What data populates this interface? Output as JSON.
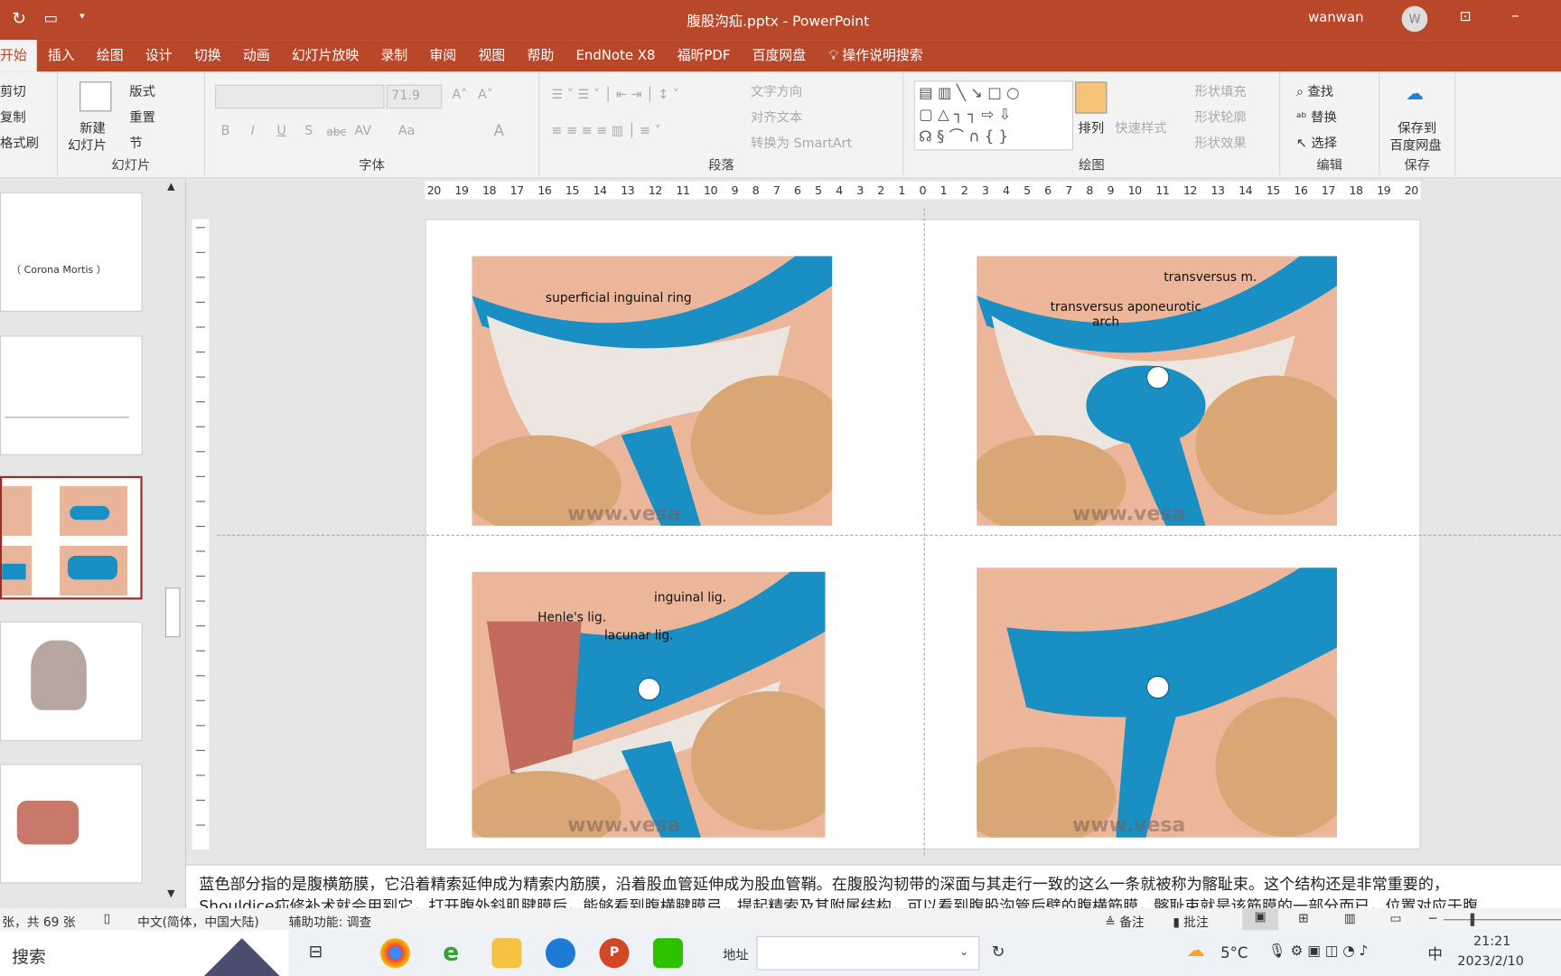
{
  "window": {
    "title": "腹股沟疝.pptx - PowerPoint",
    "user": "wanwan",
    "avatar": "W"
  },
  "tabs": [
    "开始",
    "插入",
    "绘图",
    "设计",
    "切换",
    "动画",
    "幻灯片放映",
    "录制",
    "审阅",
    "视图",
    "帮助",
    "EndNote X8",
    "福昕PDF",
    "百度网盘"
  ],
  "tell_me": "操作说明搜索",
  "ribbon": {
    "clipboard": {
      "cut": "剪切",
      "copy": "复制",
      "format_painter": "格式刷"
    },
    "slides": {
      "new_slide_1": "新建",
      "new_slide_2": "幻灯片",
      "layout": "版式",
      "reset": "重置",
      "section": "节",
      "label": "幻灯片"
    },
    "font": {
      "size": "71.9",
      "bold": "B",
      "italic": "I",
      "underline": "U",
      "shadow": "S",
      "strike": "abc",
      "spacing": "AV",
      "case": "Aa",
      "color": "A",
      "label": "字体"
    },
    "paragraph": {
      "text_direction": "文字方向",
      "align_text": "对齐文本",
      "smartart": "转换为 SmartArt",
      "label": "段落"
    },
    "drawing": {
      "arrange": "排列",
      "quick_styles": "快速样式",
      "fill": "形状填充",
      "outline": "形状轮廓",
      "effects": "形状效果",
      "label": "绘图"
    },
    "editing": {
      "find": "查找",
      "replace": "替换",
      "select": "选择",
      "label": "编辑"
    },
    "save": {
      "line1": "保存到",
      "line2": "百度网盘",
      "label": "保存"
    }
  },
  "ruler": [
    "20",
    "19",
    "18",
    "17",
    "16",
    "15",
    "14",
    "13",
    "12",
    "11",
    "10",
    "9",
    "8",
    "7",
    "6",
    "5",
    "4",
    "3",
    "2",
    "1",
    "0",
    "1",
    "2",
    "3",
    "4",
    "5",
    "6",
    "7",
    "8",
    "9",
    "10",
    "11",
    "12",
    "13",
    "14",
    "15",
    "16",
    "17",
    "18",
    "19",
    "20"
  ],
  "thumbnails": {
    "slide1_text": "（ Corona Mortis ）"
  },
  "slide": {
    "tl": {
      "label1": "superficial inguinal ring"
    },
    "tr": {
      "label1": "transversus m.",
      "label2": "transversus aponeurotic",
      "label3": "arch"
    },
    "bl": {
      "label1": "inguinal lig.",
      "label2": "Henle's lig.",
      "label3": "lacunar lig."
    },
    "watermark": "www.vesa"
  },
  "notes": {
    "line1": "蓝色部分指的是腹横筋膜，它沿着精索延伸成为精索内筋膜，沿着股血管延伸成为股血管鞘。在腹股沟韧带的深面与其走行一致的这么一条就被称为髂耻束。这个结构还是非常重要的，",
    "line2": "Shouldice疝修补术就会用到它，打开腹外斜肌腱膜后，能够看到腹横腱膜弓，提起精索及其附属结构，可以看到腹股沟管后壁的腹横筋膜，髂耻束就是该筋膜的一部分而已，位置对应于腹"
  },
  "status": {
    "slide_count": "张，共 69 张",
    "language": "中文(简体，中国大陆)",
    "accessibility": "辅助功能: 调查",
    "notes": "备注",
    "comments": "批注"
  },
  "taskbar": {
    "search": "搜索",
    "address": "地址",
    "weather": "5°C",
    "ime": "中",
    "time": "21:21",
    "date": "2023/2/10"
  },
  "colors": {
    "accent": "#B9482A",
    "fascia_blue": "#1A8FC4",
    "skin": "#EBB69A"
  }
}
